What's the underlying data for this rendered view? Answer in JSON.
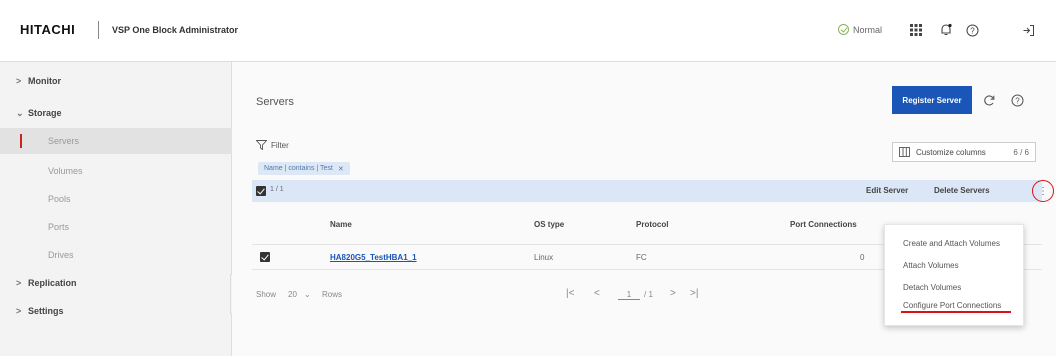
{
  "header": {
    "brand": "HITACHI",
    "app_title": "VSP One Block Administrator",
    "status": "Normal",
    "icons": [
      "apps-grid-icon",
      "notification-bell-icon",
      "help-icon",
      "logout-icon"
    ]
  },
  "sidebar": {
    "items": [
      {
        "label": "Monitor",
        "type": "parent",
        "expanded": false
      },
      {
        "label": "Storage",
        "type": "parent",
        "expanded": true
      },
      {
        "label": "Servers",
        "type": "child",
        "active": true
      },
      {
        "label": "Volumes",
        "type": "child"
      },
      {
        "label": "Pools",
        "type": "child"
      },
      {
        "label": "Ports",
        "type": "child"
      },
      {
        "label": "Drives",
        "type": "child"
      },
      {
        "label": "Replication",
        "type": "parent",
        "expanded": false
      },
      {
        "label": "Settings",
        "type": "parent",
        "expanded": false
      }
    ]
  },
  "main": {
    "title": "Servers",
    "register_button": "Register Server",
    "filter_label": "Filter",
    "filter_chip": "Name | contains | Test",
    "customize_label": "Customize columns",
    "customize_count": "6 / 6",
    "selection_count": "1 / 1",
    "edit_server": "Edit Server",
    "delete_servers": "Delete Servers",
    "columns": [
      "Name",
      "OS type",
      "Protocol",
      "Port Connections"
    ],
    "rows": [
      {
        "name": "HA820G5_TestHBA1_1",
        "os_type": "Linux",
        "protocol": "FC",
        "port_connections": "0"
      }
    ],
    "pager": {
      "show_label": "Show",
      "page_size": "20",
      "rows_label": "Rows",
      "current_page": "1",
      "total_pages": "/ 1"
    }
  },
  "menu": {
    "items": [
      "Create and Attach Volumes",
      "Attach Volumes",
      "Detach Volumes",
      "Configure Port Connections"
    ]
  },
  "colors": {
    "primary": "#1a56b8",
    "highlight": "#dd1111",
    "selection_bar": "#dbe7f7",
    "status_ok": "#8ab45a"
  }
}
